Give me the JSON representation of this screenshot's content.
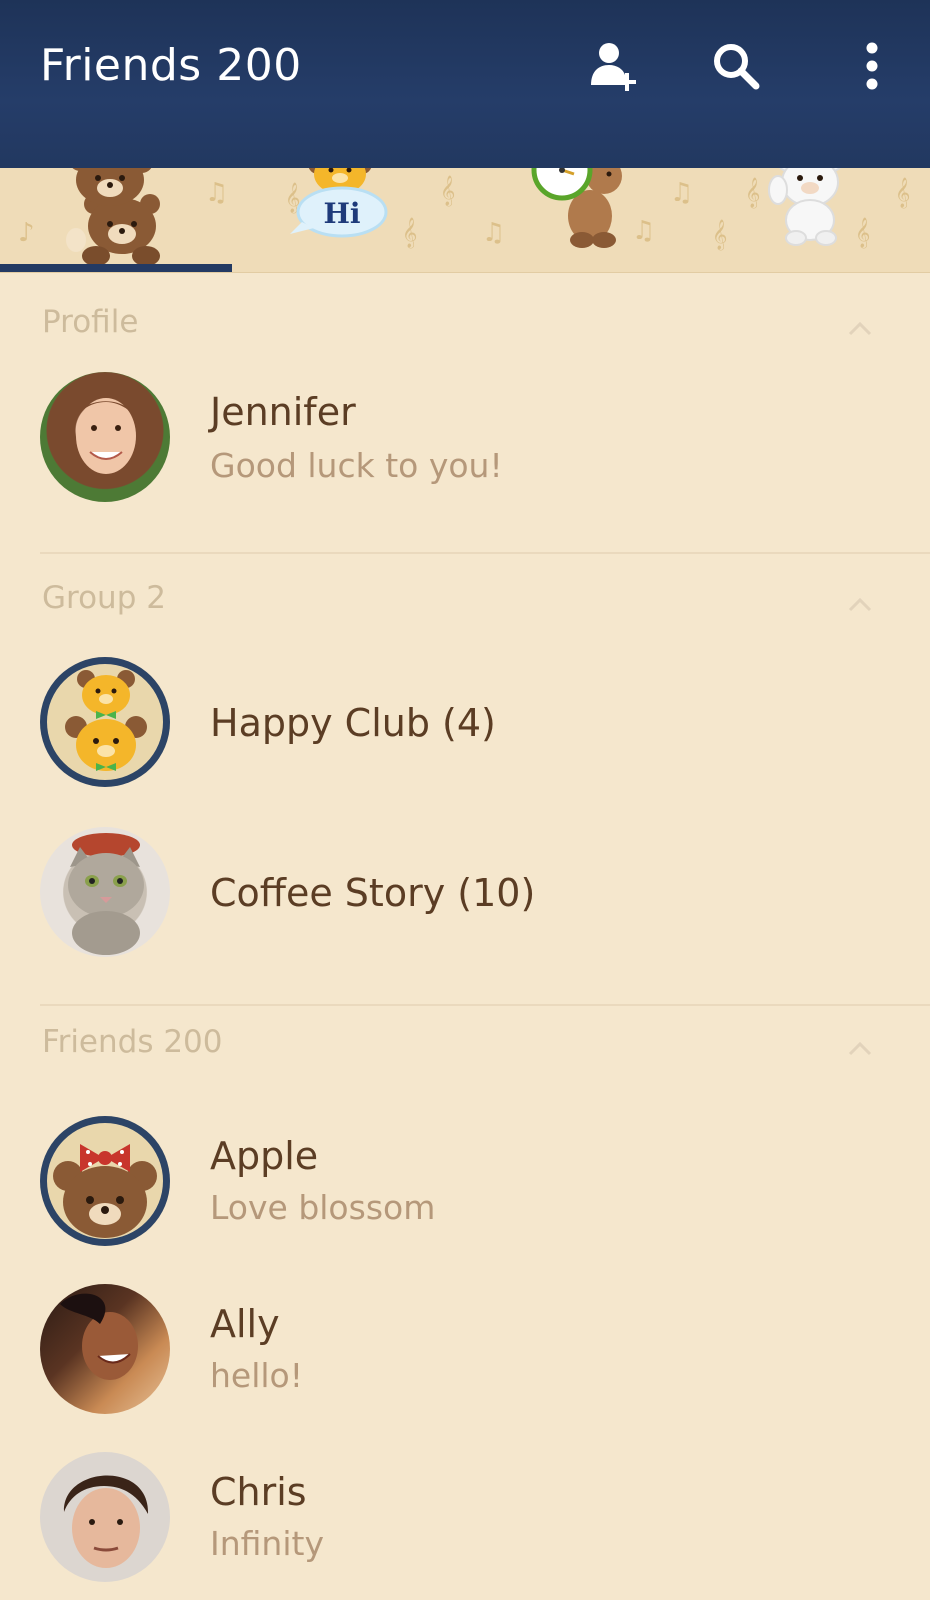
{
  "header": {
    "title": "Friends 200",
    "add_friend_icon": "add-friend-icon",
    "search_icon": "search-icon",
    "more_icon": "more-vertical-icon"
  },
  "tabs": [
    {
      "name": "friends",
      "icon": "bears-stack-icon",
      "active": true
    },
    {
      "name": "chats",
      "icon": "hi-bubble-icon",
      "label": "Hi"
    },
    {
      "name": "timeline",
      "icon": "clock-bear-icon"
    },
    {
      "name": "more",
      "icon": "white-bear-icon"
    }
  ],
  "sections": {
    "profile": {
      "label": "Profile"
    },
    "groups": {
      "label": "Group 2"
    },
    "friends": {
      "label": "Friends 200"
    }
  },
  "profile": {
    "name": "Jennifer",
    "status": "Good luck to you!"
  },
  "groups": [
    {
      "name": "Happy Club (4)"
    },
    {
      "name": "Coffee Story (10)"
    }
  ],
  "friends": [
    {
      "name": "Apple",
      "status": "Love blossom"
    },
    {
      "name": "Ally",
      "status": "hello!"
    },
    {
      "name": "Chris",
      "status": "Infinity"
    }
  ],
  "colors": {
    "header_bg": "#223860",
    "background": "#f5e7cd",
    "name_text": "#5b3d24",
    "status_text": "#b5987a",
    "accent": "#233a63"
  }
}
